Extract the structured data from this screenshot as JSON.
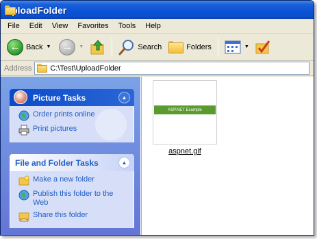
{
  "window": {
    "title": "UploadFolder"
  },
  "menu": [
    "File",
    "Edit",
    "View",
    "Favorites",
    "Tools",
    "Help"
  ],
  "toolbar": {
    "back_label": "Back",
    "search_label": "Search",
    "folders_label": "Folders"
  },
  "address": {
    "label": "Address",
    "value": "C:\\Test\\UploadFolder"
  },
  "taskpane": {
    "picture_tasks": {
      "title": "Picture Tasks",
      "items": [
        {
          "label": "Order prints online",
          "icon": "globe-icon"
        },
        {
          "label": "Print pictures",
          "icon": "printer-icon"
        }
      ]
    },
    "file_folder_tasks": {
      "title": "File and Folder Tasks",
      "items": [
        {
          "label": "Make a new folder",
          "icon": "new-folder-icon"
        },
        {
          "label": "Publish this folder to the Web",
          "icon": "publish-web-icon"
        },
        {
          "label": "Share this folder",
          "icon": "share-folder-icon"
        }
      ]
    }
  },
  "files": [
    {
      "name": "aspnet.gif",
      "thumbnail_text": "ASP.NET Example"
    }
  ],
  "colors": {
    "titlebar": "#0a53d8",
    "taskpane": "#7ba2e7",
    "link": "#215dc6",
    "thumbnail_bar": "#5a9a2e"
  }
}
